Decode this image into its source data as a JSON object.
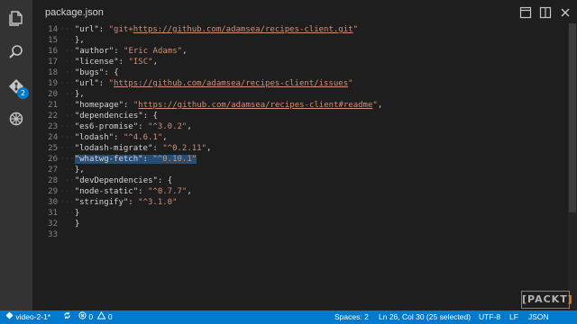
{
  "tab": {
    "title": "package.json"
  },
  "activity": {
    "icons": [
      "files-icon",
      "search-icon",
      "git-icon",
      "debug-icon"
    ],
    "git_badge": "2"
  },
  "editor": {
    "lines": [
      {
        "n": "14",
        "indent": 2,
        "tokens": [
          {
            "t": "\"url\"",
            "c": "key"
          },
          {
            "t": ": ",
            "c": "punc"
          },
          {
            "t": "\"git+",
            "c": "str"
          },
          {
            "t": "https://github.com/adamsea/recipes-client.git",
            "c": "link"
          },
          {
            "t": "\"",
            "c": "str"
          }
        ]
      },
      {
        "n": "15",
        "indent": 1,
        "tokens": [
          {
            "t": "},",
            "c": "punc"
          }
        ]
      },
      {
        "n": "16",
        "indent": 1,
        "tokens": [
          {
            "t": "\"author\"",
            "c": "key"
          },
          {
            "t": ": ",
            "c": "punc"
          },
          {
            "t": "\"Eric Adams\"",
            "c": "str"
          },
          {
            "t": ",",
            "c": "punc"
          }
        ]
      },
      {
        "n": "17",
        "indent": 1,
        "tokens": [
          {
            "t": "\"license\"",
            "c": "key"
          },
          {
            "t": ": ",
            "c": "punc"
          },
          {
            "t": "\"ISC\"",
            "c": "str"
          },
          {
            "t": ",",
            "c": "punc"
          }
        ]
      },
      {
        "n": "18",
        "indent": 1,
        "tokens": [
          {
            "t": "\"bugs\"",
            "c": "key"
          },
          {
            "t": ": {",
            "c": "punc"
          }
        ]
      },
      {
        "n": "19",
        "indent": 2,
        "tokens": [
          {
            "t": "\"url\"",
            "c": "key"
          },
          {
            "t": ": ",
            "c": "punc"
          },
          {
            "t": "\"",
            "c": "str"
          },
          {
            "t": "https://github.com/adamsea/recipes-client/issues",
            "c": "link"
          },
          {
            "t": "\"",
            "c": "str"
          }
        ]
      },
      {
        "n": "20",
        "indent": 1,
        "tokens": [
          {
            "t": "},",
            "c": "punc"
          }
        ]
      },
      {
        "n": "21",
        "indent": 1,
        "tokens": [
          {
            "t": "\"homepage\"",
            "c": "key"
          },
          {
            "t": ": ",
            "c": "punc"
          },
          {
            "t": "\"",
            "c": "str"
          },
          {
            "t": "https://github.com/adamsea/recipes-client#readme",
            "c": "link"
          },
          {
            "t": "\"",
            "c": "str"
          },
          {
            "t": ",",
            "c": "punc"
          }
        ]
      },
      {
        "n": "22",
        "indent": 1,
        "tokens": [
          {
            "t": "\"dependencies\"",
            "c": "key"
          },
          {
            "t": ": {",
            "c": "punc"
          }
        ]
      },
      {
        "n": "23",
        "indent": 2,
        "tokens": [
          {
            "t": "\"es6-promise\"",
            "c": "key"
          },
          {
            "t": ": ",
            "c": "punc"
          },
          {
            "t": "\"^3.0.2\"",
            "c": "str"
          },
          {
            "t": ",",
            "c": "punc"
          }
        ]
      },
      {
        "n": "24",
        "indent": 2,
        "tokens": [
          {
            "t": "\"lodash\"",
            "c": "key"
          },
          {
            "t": ": ",
            "c": "punc"
          },
          {
            "t": "\"^4.6.1\"",
            "c": "str"
          },
          {
            "t": ",",
            "c": "punc"
          }
        ]
      },
      {
        "n": "25",
        "indent": 2,
        "tokens": [
          {
            "t": "\"lodash-migrate\"",
            "c": "key"
          },
          {
            "t": ": ",
            "c": "punc"
          },
          {
            "t": "\"^0.2.11\"",
            "c": "str"
          },
          {
            "t": ",",
            "c": "punc"
          }
        ]
      },
      {
        "n": "26",
        "indent": 2,
        "selected": true,
        "tokens": [
          {
            "t": "\"whatwg-fetch\"",
            "c": "key"
          },
          {
            "t": ": ",
            "c": "punc"
          },
          {
            "t": "\"^0.10.1\"",
            "c": "str"
          }
        ]
      },
      {
        "n": "27",
        "indent": 1,
        "tokens": [
          {
            "t": "},",
            "c": "punc"
          }
        ]
      },
      {
        "n": "28",
        "indent": 1,
        "tokens": [
          {
            "t": "\"devDependencies\"",
            "c": "key"
          },
          {
            "t": ": {",
            "c": "punc"
          }
        ]
      },
      {
        "n": "29",
        "indent": 2,
        "tokens": [
          {
            "t": "\"node-static\"",
            "c": "key"
          },
          {
            "t": ": ",
            "c": "punc"
          },
          {
            "t": "\"^0.7.7\"",
            "c": "str"
          },
          {
            "t": ",",
            "c": "punc"
          }
        ]
      },
      {
        "n": "30",
        "indent": 2,
        "tokens": [
          {
            "t": "\"stringify\"",
            "c": "key"
          },
          {
            "t": ": ",
            "c": "punc"
          },
          {
            "t": "\"^3.1.0\"",
            "c": "str"
          }
        ]
      },
      {
        "n": "31",
        "indent": 1,
        "tokens": [
          {
            "t": "}",
            "c": "punc"
          }
        ]
      },
      {
        "n": "32",
        "indent": 0,
        "tokens": [
          {
            "t": "}",
            "c": "punc"
          }
        ]
      },
      {
        "n": "33",
        "indent": 0,
        "tokens": []
      }
    ]
  },
  "status": {
    "branch": "video-2-1*",
    "errors": "0",
    "warnings": "0",
    "indent": "Spaces: 2",
    "position": "Ln 26, Col 30 (25 selected)",
    "encoding": "UTF-8",
    "eol": "LF",
    "language": "JSON"
  },
  "colors": {
    "accent": "#007acc",
    "string": "#ce9178",
    "selection": "#264f78"
  }
}
